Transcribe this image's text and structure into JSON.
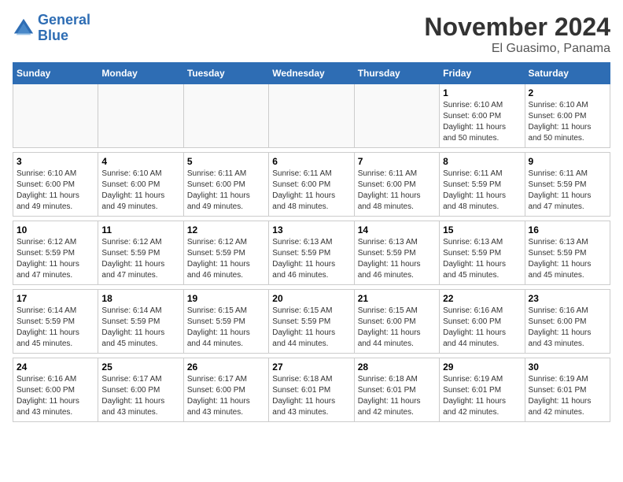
{
  "header": {
    "logo_line1": "General",
    "logo_line2": "Blue",
    "month_title": "November 2024",
    "subtitle": "El Guasimo, Panama"
  },
  "days_of_week": [
    "Sunday",
    "Monday",
    "Tuesday",
    "Wednesday",
    "Thursday",
    "Friday",
    "Saturday"
  ],
  "weeks": [
    [
      {
        "day": "",
        "info": ""
      },
      {
        "day": "",
        "info": ""
      },
      {
        "day": "",
        "info": ""
      },
      {
        "day": "",
        "info": ""
      },
      {
        "day": "",
        "info": ""
      },
      {
        "day": "1",
        "info": "Sunrise: 6:10 AM\nSunset: 6:00 PM\nDaylight: 11 hours\nand 50 minutes."
      },
      {
        "day": "2",
        "info": "Sunrise: 6:10 AM\nSunset: 6:00 PM\nDaylight: 11 hours\nand 50 minutes."
      }
    ],
    [
      {
        "day": "3",
        "info": "Sunrise: 6:10 AM\nSunset: 6:00 PM\nDaylight: 11 hours\nand 49 minutes."
      },
      {
        "day": "4",
        "info": "Sunrise: 6:10 AM\nSunset: 6:00 PM\nDaylight: 11 hours\nand 49 minutes."
      },
      {
        "day": "5",
        "info": "Sunrise: 6:11 AM\nSunset: 6:00 PM\nDaylight: 11 hours\nand 49 minutes."
      },
      {
        "day": "6",
        "info": "Sunrise: 6:11 AM\nSunset: 6:00 PM\nDaylight: 11 hours\nand 48 minutes."
      },
      {
        "day": "7",
        "info": "Sunrise: 6:11 AM\nSunset: 6:00 PM\nDaylight: 11 hours\nand 48 minutes."
      },
      {
        "day": "8",
        "info": "Sunrise: 6:11 AM\nSunset: 5:59 PM\nDaylight: 11 hours\nand 48 minutes."
      },
      {
        "day": "9",
        "info": "Sunrise: 6:11 AM\nSunset: 5:59 PM\nDaylight: 11 hours\nand 47 minutes."
      }
    ],
    [
      {
        "day": "10",
        "info": "Sunrise: 6:12 AM\nSunset: 5:59 PM\nDaylight: 11 hours\nand 47 minutes."
      },
      {
        "day": "11",
        "info": "Sunrise: 6:12 AM\nSunset: 5:59 PM\nDaylight: 11 hours\nand 47 minutes."
      },
      {
        "day": "12",
        "info": "Sunrise: 6:12 AM\nSunset: 5:59 PM\nDaylight: 11 hours\nand 46 minutes."
      },
      {
        "day": "13",
        "info": "Sunrise: 6:13 AM\nSunset: 5:59 PM\nDaylight: 11 hours\nand 46 minutes."
      },
      {
        "day": "14",
        "info": "Sunrise: 6:13 AM\nSunset: 5:59 PM\nDaylight: 11 hours\nand 46 minutes."
      },
      {
        "day": "15",
        "info": "Sunrise: 6:13 AM\nSunset: 5:59 PM\nDaylight: 11 hours\nand 45 minutes."
      },
      {
        "day": "16",
        "info": "Sunrise: 6:13 AM\nSunset: 5:59 PM\nDaylight: 11 hours\nand 45 minutes."
      }
    ],
    [
      {
        "day": "17",
        "info": "Sunrise: 6:14 AM\nSunset: 5:59 PM\nDaylight: 11 hours\nand 45 minutes."
      },
      {
        "day": "18",
        "info": "Sunrise: 6:14 AM\nSunset: 5:59 PM\nDaylight: 11 hours\nand 45 minutes."
      },
      {
        "day": "19",
        "info": "Sunrise: 6:15 AM\nSunset: 5:59 PM\nDaylight: 11 hours\nand 44 minutes."
      },
      {
        "day": "20",
        "info": "Sunrise: 6:15 AM\nSunset: 5:59 PM\nDaylight: 11 hours\nand 44 minutes."
      },
      {
        "day": "21",
        "info": "Sunrise: 6:15 AM\nSunset: 6:00 PM\nDaylight: 11 hours\nand 44 minutes."
      },
      {
        "day": "22",
        "info": "Sunrise: 6:16 AM\nSunset: 6:00 PM\nDaylight: 11 hours\nand 44 minutes."
      },
      {
        "day": "23",
        "info": "Sunrise: 6:16 AM\nSunset: 6:00 PM\nDaylight: 11 hours\nand 43 minutes."
      }
    ],
    [
      {
        "day": "24",
        "info": "Sunrise: 6:16 AM\nSunset: 6:00 PM\nDaylight: 11 hours\nand 43 minutes."
      },
      {
        "day": "25",
        "info": "Sunrise: 6:17 AM\nSunset: 6:00 PM\nDaylight: 11 hours\nand 43 minutes."
      },
      {
        "day": "26",
        "info": "Sunrise: 6:17 AM\nSunset: 6:00 PM\nDaylight: 11 hours\nand 43 minutes."
      },
      {
        "day": "27",
        "info": "Sunrise: 6:18 AM\nSunset: 6:01 PM\nDaylight: 11 hours\nand 43 minutes."
      },
      {
        "day": "28",
        "info": "Sunrise: 6:18 AM\nSunset: 6:01 PM\nDaylight: 11 hours\nand 42 minutes."
      },
      {
        "day": "29",
        "info": "Sunrise: 6:19 AM\nSunset: 6:01 PM\nDaylight: 11 hours\nand 42 minutes."
      },
      {
        "day": "30",
        "info": "Sunrise: 6:19 AM\nSunset: 6:01 PM\nDaylight: 11 hours\nand 42 minutes."
      }
    ]
  ]
}
